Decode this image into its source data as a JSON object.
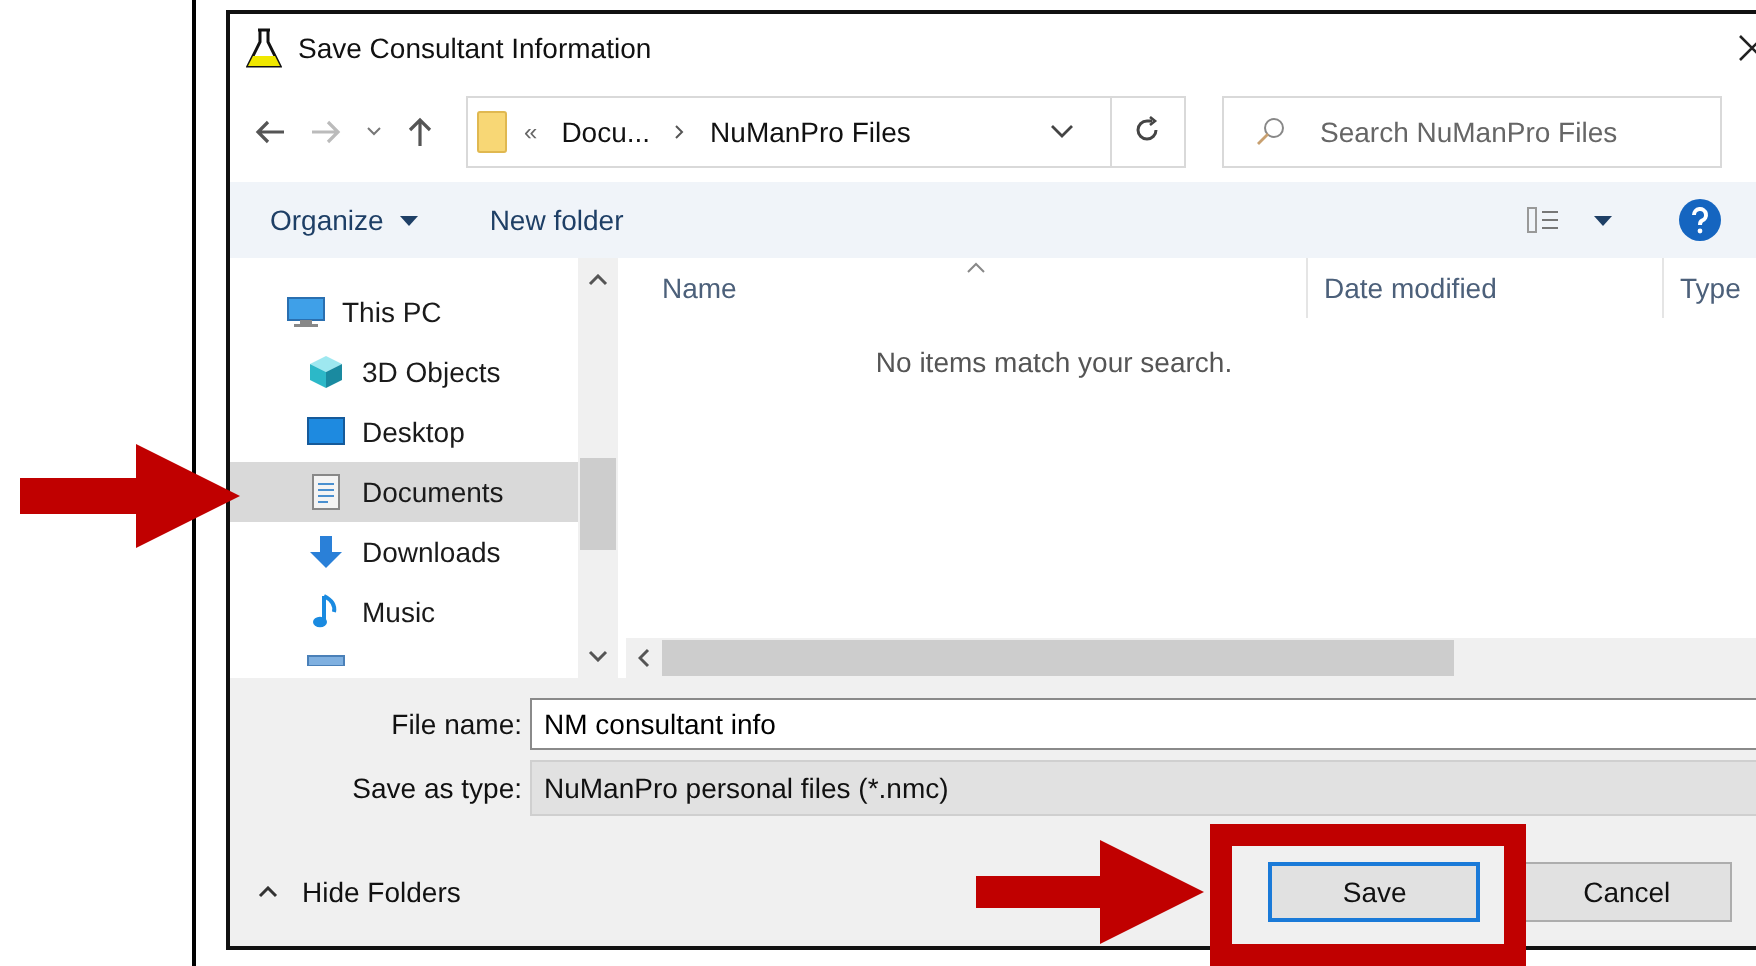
{
  "window": {
    "title": "Save Consultant Information"
  },
  "breadcrumb_overflow": "«",
  "breadcrumb": [
    {
      "label": "Docu..."
    },
    {
      "label": "NuManPro Files"
    }
  ],
  "search": {
    "placeholder": "Search NuManPro Files"
  },
  "toolbar": {
    "organize": "Organize",
    "new_folder": "New folder"
  },
  "nav_items": [
    {
      "label": "This PC",
      "kind": "pc",
      "selected": false,
      "children": [
        {
          "label": "3D Objects",
          "kind": "cube",
          "selected": false
        },
        {
          "label": "Desktop",
          "kind": "desktop",
          "selected": false
        },
        {
          "label": "Documents",
          "kind": "documents",
          "selected": true
        },
        {
          "label": "Downloads",
          "kind": "downloads",
          "selected": false
        },
        {
          "label": "Music",
          "kind": "music",
          "selected": false
        }
      ]
    }
  ],
  "columns": [
    {
      "label": "Name"
    },
    {
      "label": "Date modified"
    },
    {
      "label": "Type"
    }
  ],
  "empty_message": "No items match your search.",
  "file_name": {
    "label": "File name:",
    "value": "NM consultant info"
  },
  "save_type": {
    "label": "Save as type:",
    "value": "NuManPro personal files (*.nmc)"
  },
  "hide_folders": "Hide Folders",
  "buttons": [
    {
      "label": "Save",
      "selected": true
    },
    {
      "label": "Cancel",
      "selected": false
    }
  ]
}
